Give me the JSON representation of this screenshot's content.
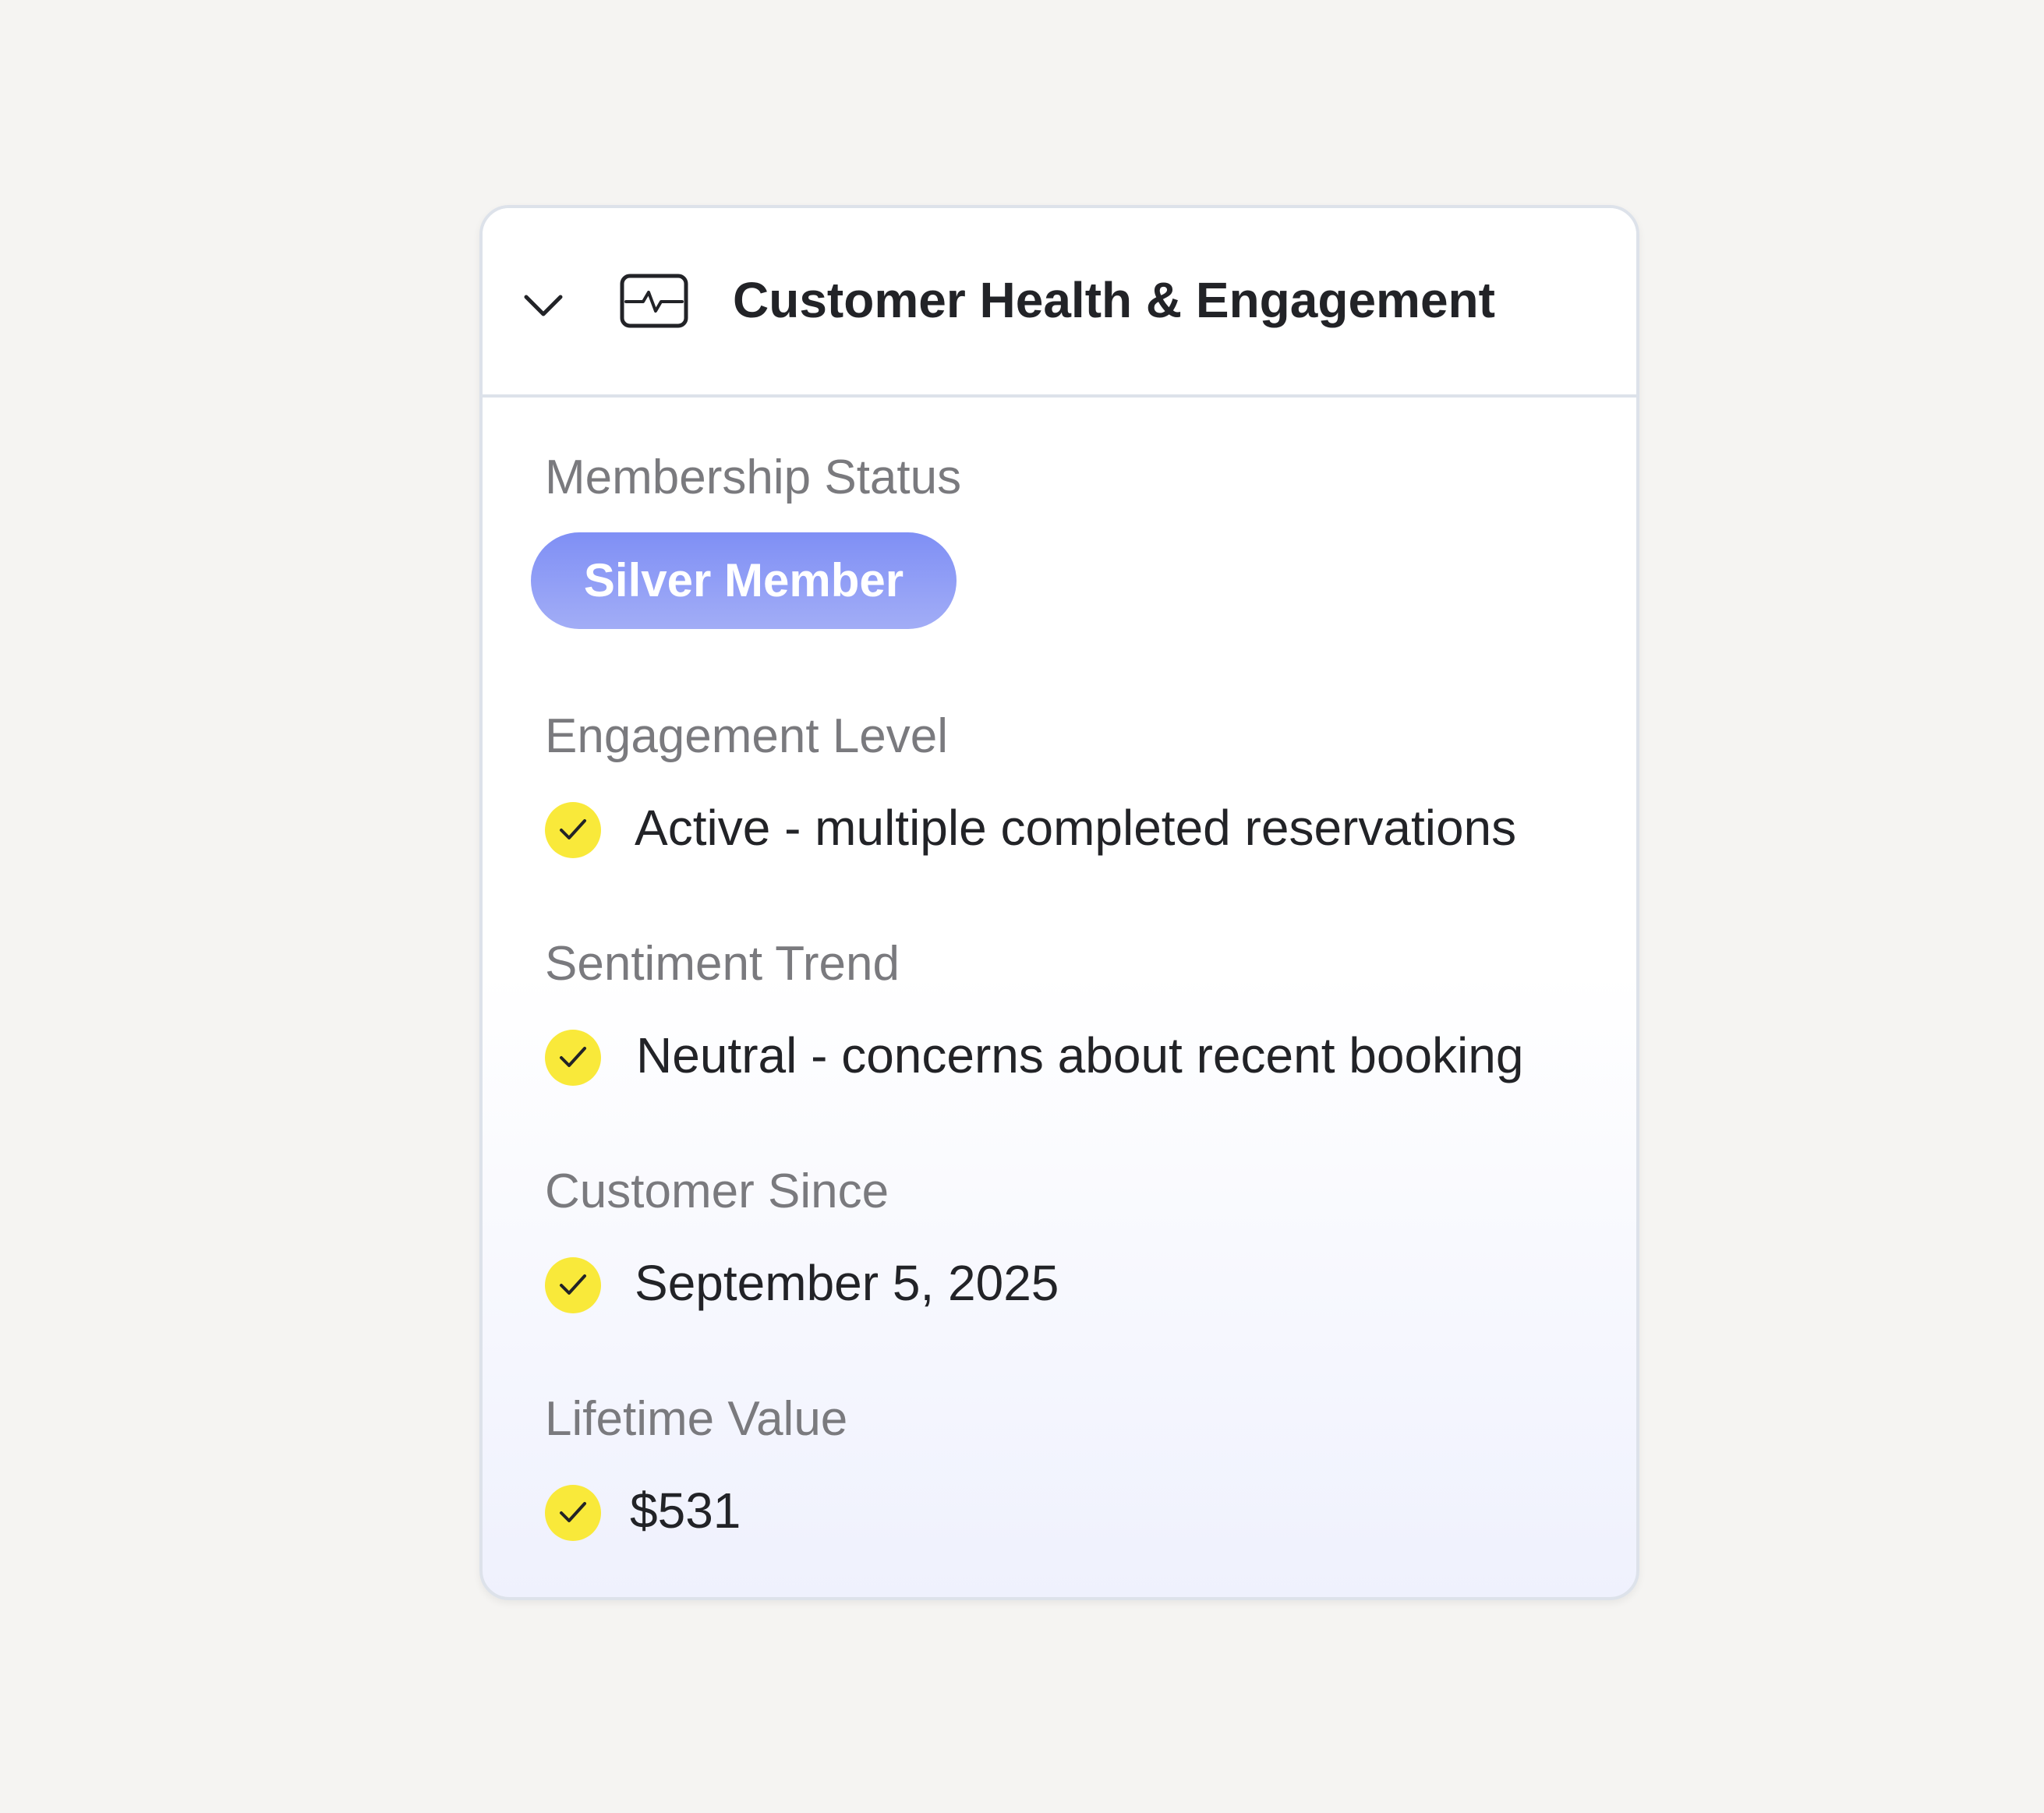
{
  "card": {
    "title": "Customer Health & Engagement",
    "header_icon": "pulse-monitor-icon",
    "toggle_icon": "chevron-down-icon"
  },
  "membership": {
    "label": "Membership Status",
    "badge": "Silver Member",
    "badge_color": "#8b98f4"
  },
  "engagement": {
    "label": "Engagement Level",
    "value": "Active - multiple completed reservations",
    "icon": "check-circle-icon"
  },
  "sentiment": {
    "label": "Sentiment Trend",
    "value": "Neutral - concerns about recent booking",
    "icon": "check-circle-icon"
  },
  "customer_since": {
    "label": "Customer Since",
    "value": "September 5, 2025",
    "icon": "check-circle-icon"
  },
  "lifetime_value": {
    "label": "Lifetime Value",
    "value": "$531",
    "icon": "check-circle-icon"
  },
  "colors": {
    "check_fill": "#f9e93a",
    "text_primary": "#222327",
    "text_secondary": "#7a7a7e"
  }
}
